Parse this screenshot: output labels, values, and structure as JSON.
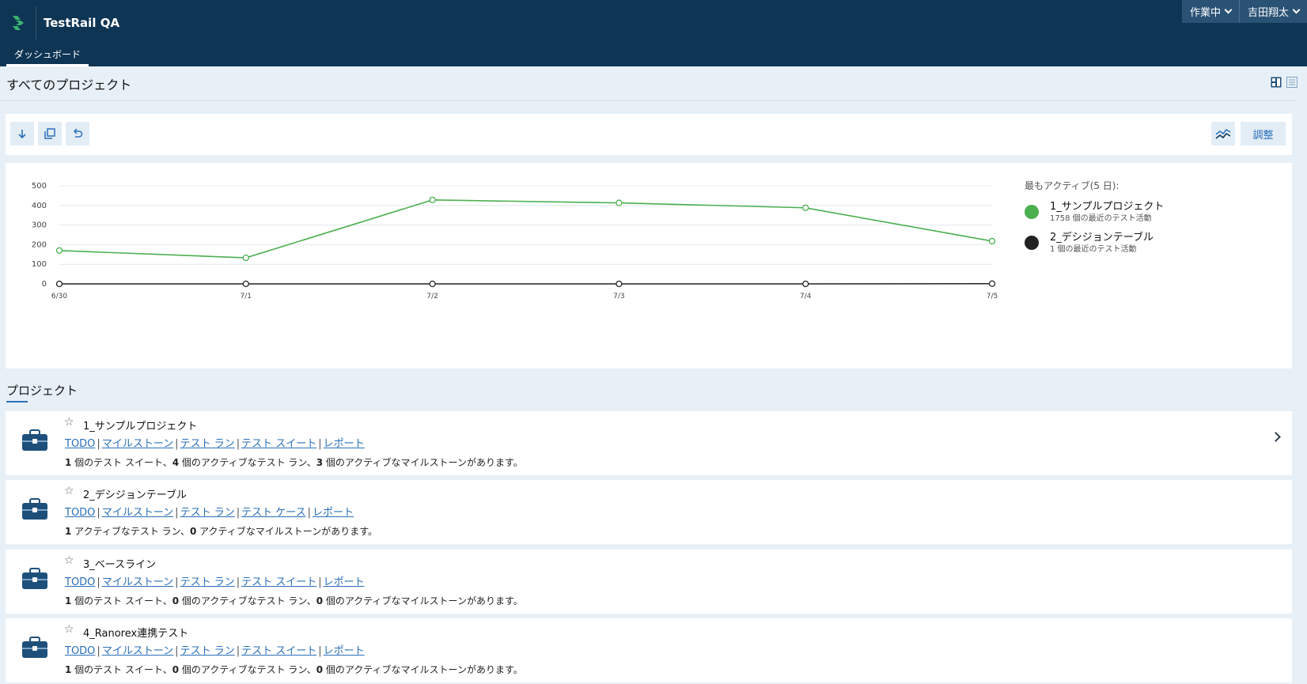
{
  "header": {
    "app_title": "TestRail QA",
    "nav_tab": "ダッシュボード",
    "status_label": "作業中",
    "user_label": "吉田翔太"
  },
  "page": {
    "title": "すべてのプロジェクト"
  },
  "toolbar": {
    "adjust_label": "調整"
  },
  "chart_data": {
    "type": "line",
    "x": [
      "6/30",
      "7/1",
      "7/2",
      "7/3",
      "7/4",
      "7/5"
    ],
    "yticks": [
      0,
      100,
      200,
      300,
      400,
      500
    ],
    "ylim": [
      0,
      500
    ],
    "series": [
      {
        "name": "1_サンプルプロジェクト",
        "color": "#4caf50",
        "values": [
          170,
          133,
          428,
          413,
          388,
          218
        ]
      },
      {
        "name": "2_デシジョンテーブル",
        "color": "#222222",
        "values": [
          0,
          0,
          0,
          0,
          0,
          1
        ]
      }
    ],
    "legend_title": "最もアクティブ(5 日):",
    "legend_subs": [
      "1758 個の最近のテスト活動",
      "1 個の最近のテスト活動"
    ]
  },
  "projects_section": {
    "title": "プロジェクト"
  },
  "projects": [
    {
      "name": "1_サンプルプロジェクト",
      "links": [
        "TODO",
        "マイルストーン",
        "テスト ラン",
        "テスト スイート",
        "レポート"
      ],
      "desc": [
        {
          "b": "1",
          "t": " 個のテスト スイート、"
        },
        {
          "b": "4",
          "t": " 個のアクティブなテスト ラン、"
        },
        {
          "b": "3",
          "t": " 個のアクティブなマイルストーンがあります。"
        }
      ]
    },
    {
      "name": "2_デシジョンテーブル",
      "links": [
        "TODO",
        "マイルストーン",
        "テスト ラン",
        "テスト ケース",
        "レポート"
      ],
      "desc": [
        {
          "b": "1",
          "t": " アクティブなテスト ラン、"
        },
        {
          "b": "0",
          "t": " アクティブなマイルストーンがあります。"
        }
      ]
    },
    {
      "name": "3_ベースライン",
      "links": [
        "TODO",
        "マイルストーン",
        "テスト ラン",
        "テスト スイート",
        "レポート"
      ],
      "desc": [
        {
          "b": "1",
          "t": " 個のテスト スイート、"
        },
        {
          "b": "0",
          "t": " 個のアクティブなテスト ラン、"
        },
        {
          "b": "0",
          "t": " 個のアクティブなマイルストーンがあります。"
        }
      ]
    },
    {
      "name": "4_Ranorex連携テスト",
      "links": [
        "TODO",
        "マイルストーン",
        "テスト ラン",
        "テスト スイート",
        "レポート"
      ],
      "desc": [
        {
          "b": "1",
          "t": " 個のテスト スイート、"
        },
        {
          "b": "0",
          "t": " 個のアクティブなテスト ラン、"
        },
        {
          "b": "0",
          "t": " 個のアクティブなマイルストーンがあります。"
        }
      ]
    }
  ],
  "colors": {
    "header_bg": "#0f3554",
    "accent": "#2a6fb8",
    "series_green": "#4caf50",
    "series_black": "#222222"
  },
  "icons": [
    "testrail-logo-icon",
    "download-icon",
    "copy-icon",
    "undo-icon",
    "chart-lines-icon",
    "dashboard-view-icon",
    "list-view-icon",
    "briefcase-icon",
    "star-icon",
    "chevron-right-icon"
  ]
}
